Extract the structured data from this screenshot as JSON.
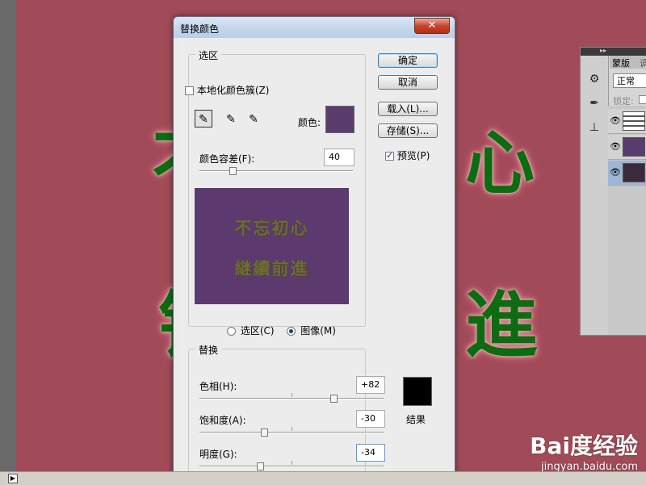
{
  "canvas": {
    "background_color": "#a24b58",
    "glyphs": [
      "不",
      "心",
      "铨",
      "進"
    ]
  },
  "watermark": {
    "logo": "Bai度经验",
    "url": "jingyan.baidu.com"
  },
  "right_panel": {
    "tabs": [
      "蒙版",
      "调"
    ],
    "blend_mode": "正常",
    "lock_label": "锁定:",
    "layers_count": 3
  },
  "dialog": {
    "title": "替换颜色",
    "close_symbol": "✕",
    "selection_group": {
      "legend": "选区",
      "localized_label": "本地化颜色簇(Z)",
      "localized_checked": false,
      "color_label": "颜色:",
      "color_value": "#5b3c6e",
      "fuzziness_label": "颜色容差(F):",
      "fuzziness_value": "40",
      "preview_lines": [
        "不忘初心",
        "継續前進"
      ],
      "radio_selection_label": "选区(C)",
      "radio_image_label": "图像(M)",
      "selected_mode": "image"
    },
    "buttons": {
      "ok": "确定",
      "cancel": "取消",
      "load": "载入(L)...",
      "save": "存储(S)..."
    },
    "preview_label": "预览(P)",
    "preview_checked": true,
    "replace_group": {
      "legend": "替换",
      "hue_label": "色相(H):",
      "hue_value": "+82",
      "saturation_label": "饱和度(A):",
      "saturation_value": "-30",
      "lightness_label": "明度(G):",
      "lightness_value": "-34",
      "result_label": "结果",
      "result_color": "#000000"
    }
  }
}
